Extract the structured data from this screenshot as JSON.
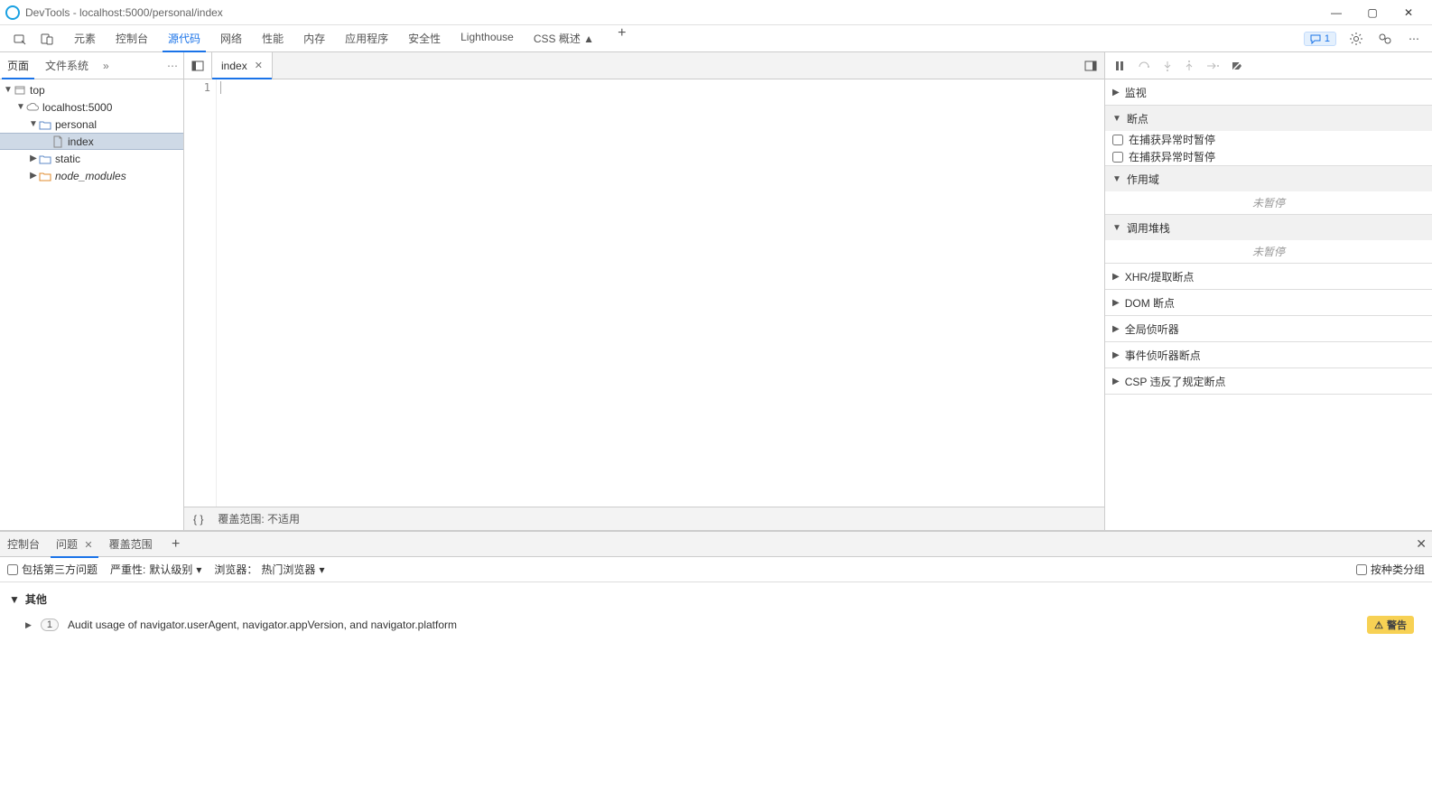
{
  "window": {
    "title": "DevTools - localhost:5000/personal/index"
  },
  "mainTabs": {
    "items": [
      "元素",
      "控制台",
      "源代码",
      "网络",
      "性能",
      "内存",
      "应用程序",
      "安全性",
      "Lighthouse",
      "CSS 概述 ▲"
    ],
    "activeIndex": 2,
    "issueCount": "1"
  },
  "subTabs": {
    "page": "页面",
    "fileSystem": "文件系统"
  },
  "tree": {
    "top": "top",
    "host": "localhost:5000",
    "personal": "personal",
    "index": "index",
    "static": "static",
    "node_modules": "node_modules"
  },
  "fileTab": {
    "name": "index"
  },
  "editor": {
    "lineNumber": "1"
  },
  "centerStatus": {
    "braces": "{ }",
    "coverage": "覆盖范围: 不适用"
  },
  "debug": {
    "monitor": "监视",
    "breakpoints": "断点",
    "pauseCaught1": "在捕获异常时暂停",
    "pauseCaught2": "在捕获异常时暂停",
    "scope": "作用域",
    "callstack": "调用堆栈",
    "notPaused": "未暂停",
    "xhr": "XHR/提取断点",
    "dom": "DOM 断点",
    "global": "全局侦听器",
    "event": "事件侦听器断点",
    "csp": "CSP 违反了规定断点"
  },
  "drawer": {
    "tabs": {
      "console": "控制台",
      "issues": "问题",
      "coverage": "覆盖范围"
    },
    "toolbar": {
      "thirdParty": "包括第三方问题",
      "severityLabel": "严重性:",
      "severityValue": "默认级别",
      "browserLabel": "浏览器：",
      "browserValue": "热门浏览器",
      "groupByKind": "按种类分组"
    },
    "group": "其他",
    "issue": {
      "count": "1",
      "text": "Audit usage of navigator.userAgent, navigator.appVersion, and navigator.platform",
      "badge": "警告"
    }
  }
}
